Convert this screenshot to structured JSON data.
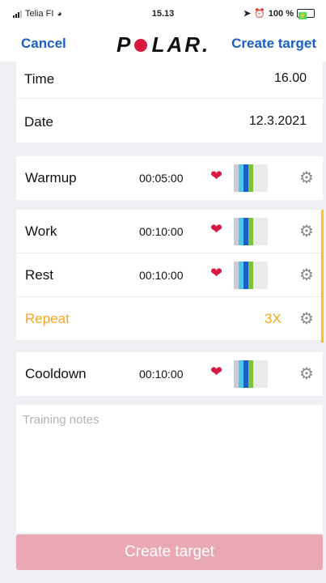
{
  "status_bar": {
    "carrier": "Telia FI",
    "time": "15.13",
    "battery": "100 %"
  },
  "nav": {
    "cancel_label": "Cancel",
    "logo_text": "POLAR",
    "create_label": "Create target"
  },
  "schedule": {
    "time_label": "Time",
    "time_value": "16.00",
    "date_label": "Date",
    "date_value": "12.3.2021"
  },
  "phases": {
    "warmup": {
      "label": "Warmup",
      "duration": "00:05:00"
    },
    "work": {
      "label": "Work",
      "duration": "00:10:00"
    },
    "rest": {
      "label": "Rest",
      "duration": "00:10:00"
    },
    "repeat": {
      "label": "Repeat",
      "count": "3X"
    },
    "cooldown": {
      "label": "Cooldown",
      "duration": "00:10:00"
    }
  },
  "icons": {
    "heart": "heart-icon",
    "gear": "gear-icon"
  },
  "colors": {
    "accent": "#1a5fc9",
    "brand_red": "#d8193f",
    "repeat_orange": "#f5a623",
    "repeat_bracket": "#f5c518"
  },
  "notes": {
    "placeholder": "Training notes"
  },
  "create_button": {
    "label": "Create target"
  }
}
